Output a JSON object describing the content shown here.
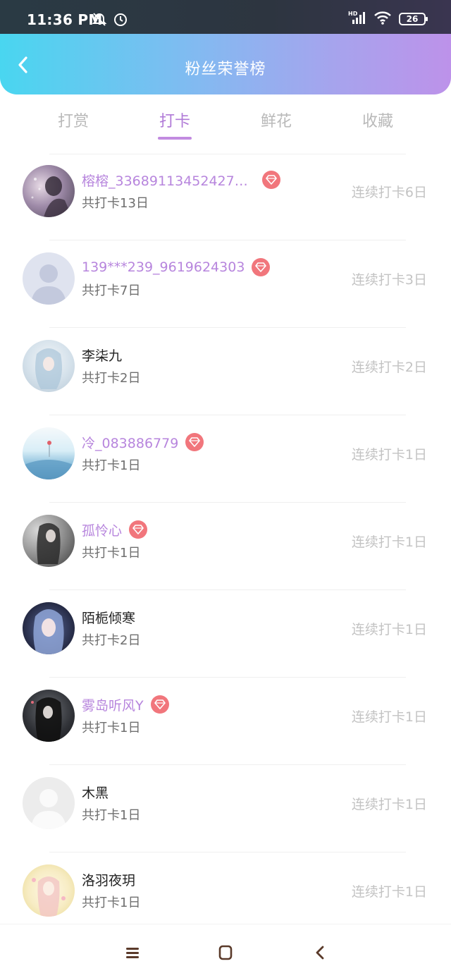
{
  "status_bar": {
    "time": "11:36 PM",
    "battery": "26",
    "icons_left": [
      "mute-bell-icon",
      "alarm-icon"
    ],
    "icons_right": [
      "hd-signal-icon",
      "wifi-icon",
      "battery-icon"
    ]
  },
  "header": {
    "title": "粉丝荣誉榜",
    "back_icon": "chevron-left-icon",
    "gradient": [
      "#49d6f0",
      "#84b9f1",
      "#bd92ea"
    ]
  },
  "tabs": [
    {
      "label": "打赏",
      "active": false
    },
    {
      "label": "打卡",
      "active": true
    },
    {
      "label": "鲜花",
      "active": false
    },
    {
      "label": "收藏",
      "active": false
    }
  ],
  "colors": {
    "accent": "#b07ad7",
    "vip_name": "#b785dd",
    "vip_badge": "#f1767c",
    "muted": "#c3c3c3"
  },
  "fans": [
    {
      "name": "榕榕_336891134524278...",
      "vip": true,
      "total": "共打卡13日",
      "streak": "连续打卡6日"
    },
    {
      "name": "139***239_9619624303",
      "vip": true,
      "total": "共打卡7日",
      "streak": "连续打卡3日"
    },
    {
      "name": "李柒九",
      "vip": false,
      "total": "共打卡2日",
      "streak": "连续打卡2日"
    },
    {
      "name": "冷_083886779",
      "vip": true,
      "total": "共打卡1日",
      "streak": "连续打卡1日"
    },
    {
      "name": "孤怜心",
      "vip": true,
      "total": "共打卡1日",
      "streak": "连续打卡1日"
    },
    {
      "name": "陌栀倾寒",
      "vip": false,
      "total": "共打卡2日",
      "streak": "连续打卡1日"
    },
    {
      "name": "雾岛听风Y",
      "vip": true,
      "total": "共打卡1日",
      "streak": "连续打卡1日"
    },
    {
      "name": "木黑",
      "vip": false,
      "total": "共打卡1日",
      "streak": "连续打卡1日"
    },
    {
      "name": "洛羽夜玥",
      "vip": false,
      "total": "共打卡1日",
      "streak": "连续打卡1日"
    }
  ],
  "bottom_nav": [
    "menu-icon",
    "home-square-icon",
    "back-chevron-icon"
  ]
}
